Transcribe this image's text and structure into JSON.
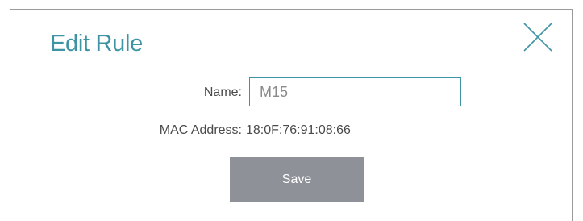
{
  "dialog": {
    "title": "Edit Rule",
    "close_icon": "close-icon"
  },
  "form": {
    "name_label": "Name:",
    "name_value": "M15",
    "mac_label": "MAC Address:",
    "mac_value": "18:0F:76:91:08:66",
    "save_label": "Save"
  },
  "colors": {
    "accent": "#3e93a4",
    "button": "#8f9199",
    "text": "#4a4a4a"
  }
}
